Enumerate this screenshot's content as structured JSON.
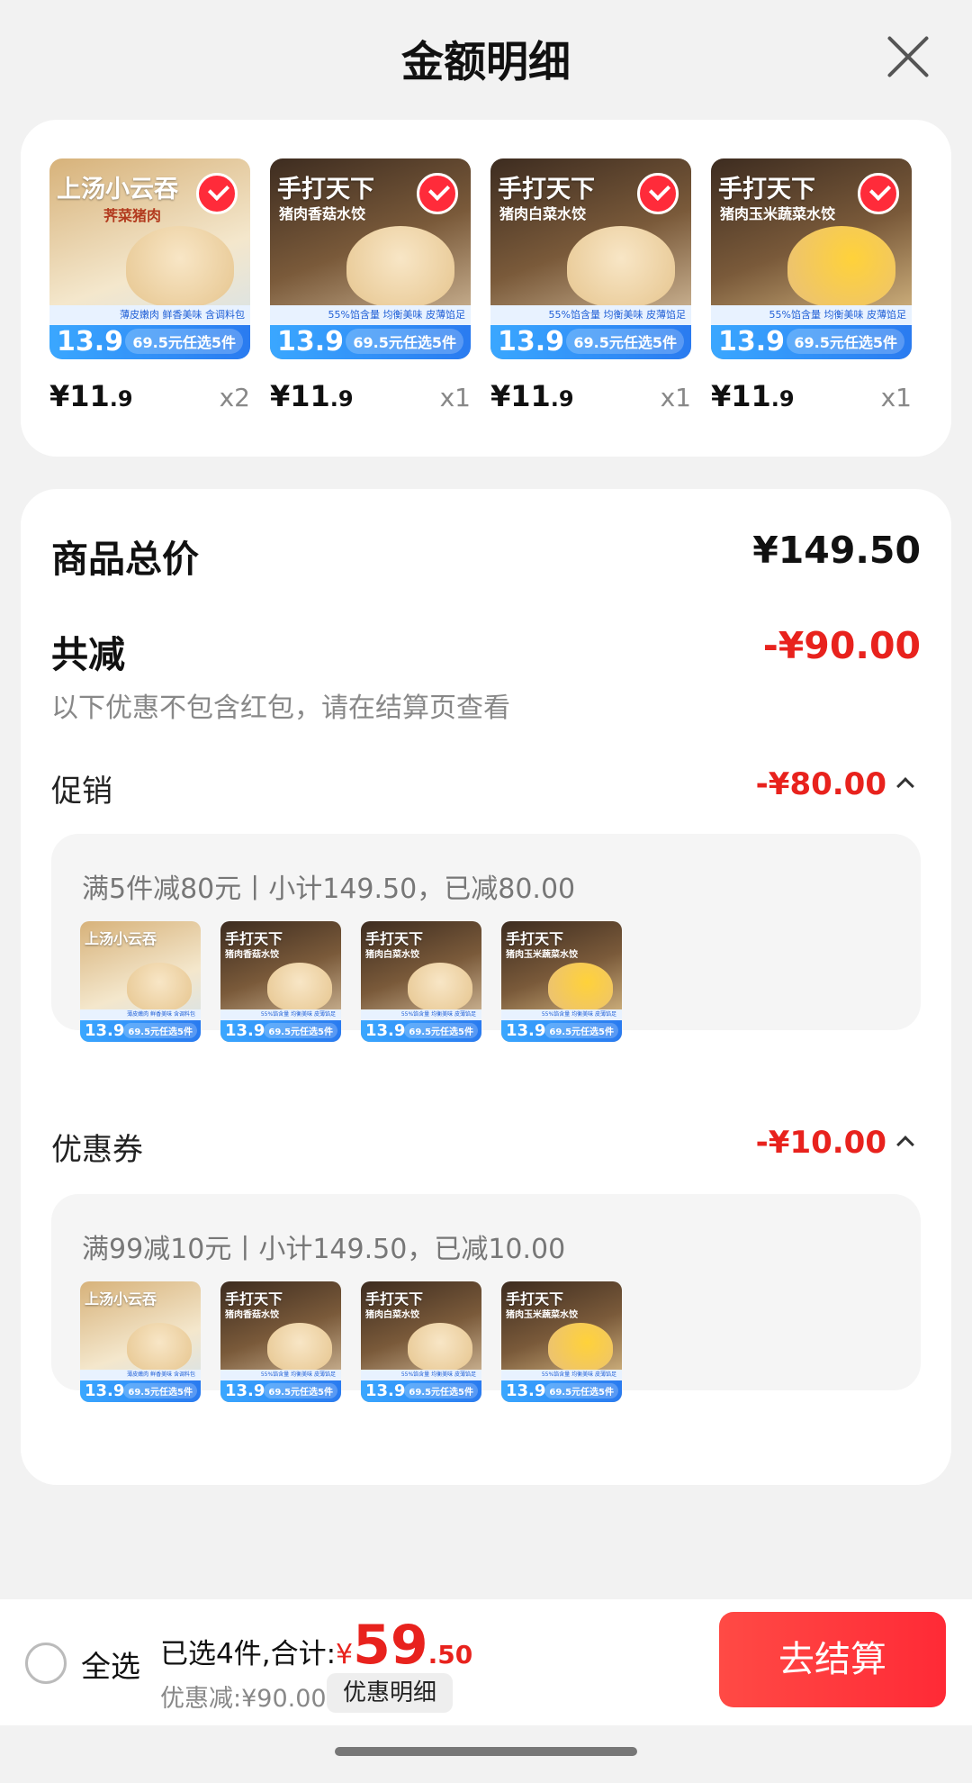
{
  "header": {
    "title": "金额明细"
  },
  "products": [
    {
      "img_title": "上汤小云吞",
      "img_sub": "荠菜猪肉",
      "price_int": "¥11",
      "price_dec": ".9",
      "qty": "x2",
      "big": "13.9",
      "tag": "69.5元任选5件",
      "strip": "薄皮嫩肉 鲜香美味 含调料包"
    },
    {
      "img_title": "手打天下",
      "img_sub": "猪肉香菇水饺",
      "price_int": "¥11",
      "price_dec": ".9",
      "qty": "x1",
      "big": "13.9",
      "tag": "69.5元任选5件",
      "strip": "55%馅含量 均衡美味 皮薄馅足"
    },
    {
      "img_title": "手打天下",
      "img_sub": "猪肉白菜水饺",
      "price_int": "¥11",
      "price_dec": ".9",
      "qty": "x1",
      "big": "13.9",
      "tag": "69.5元任选5件",
      "strip": "55%馅含量 均衡美味 皮薄馅足"
    },
    {
      "img_title": "手打天下",
      "img_sub": "猪肉玉米蔬菜水饺",
      "price_int": "¥11",
      "price_dec": ".9",
      "qty": "x1",
      "big": "13.9",
      "tag": "69.5元任选5件",
      "strip": "55%馅含量 均衡美味 皮薄馅足"
    }
  ],
  "summary": {
    "total_label": "商品总价",
    "total_value": "¥149.50",
    "reduce_label": "共减",
    "reduce_value": "-¥90.00",
    "note": "以下优惠不包含红包，请在结算页查看"
  },
  "promo": {
    "label": "促销",
    "value": "-¥80.00",
    "detail": "满5件减80元丨小计149.50，已减80.00"
  },
  "coupon": {
    "label": "优惠券",
    "value": "-¥10.00",
    "detail": "满99减10元丨小计149.50，已减10.00"
  },
  "bottom": {
    "select_all": "全选",
    "selected": "已选4件,合计:",
    "currency": "¥",
    "amount_int": "59",
    "amount_dec": ".50",
    "discount": "优惠减:¥90.00",
    "detail_button": "优惠明细",
    "checkout": "去结算"
  },
  "colors": {
    "accent": "#e8221d",
    "checkout": "#ff2a36",
    "band": "#2a7bf0"
  }
}
